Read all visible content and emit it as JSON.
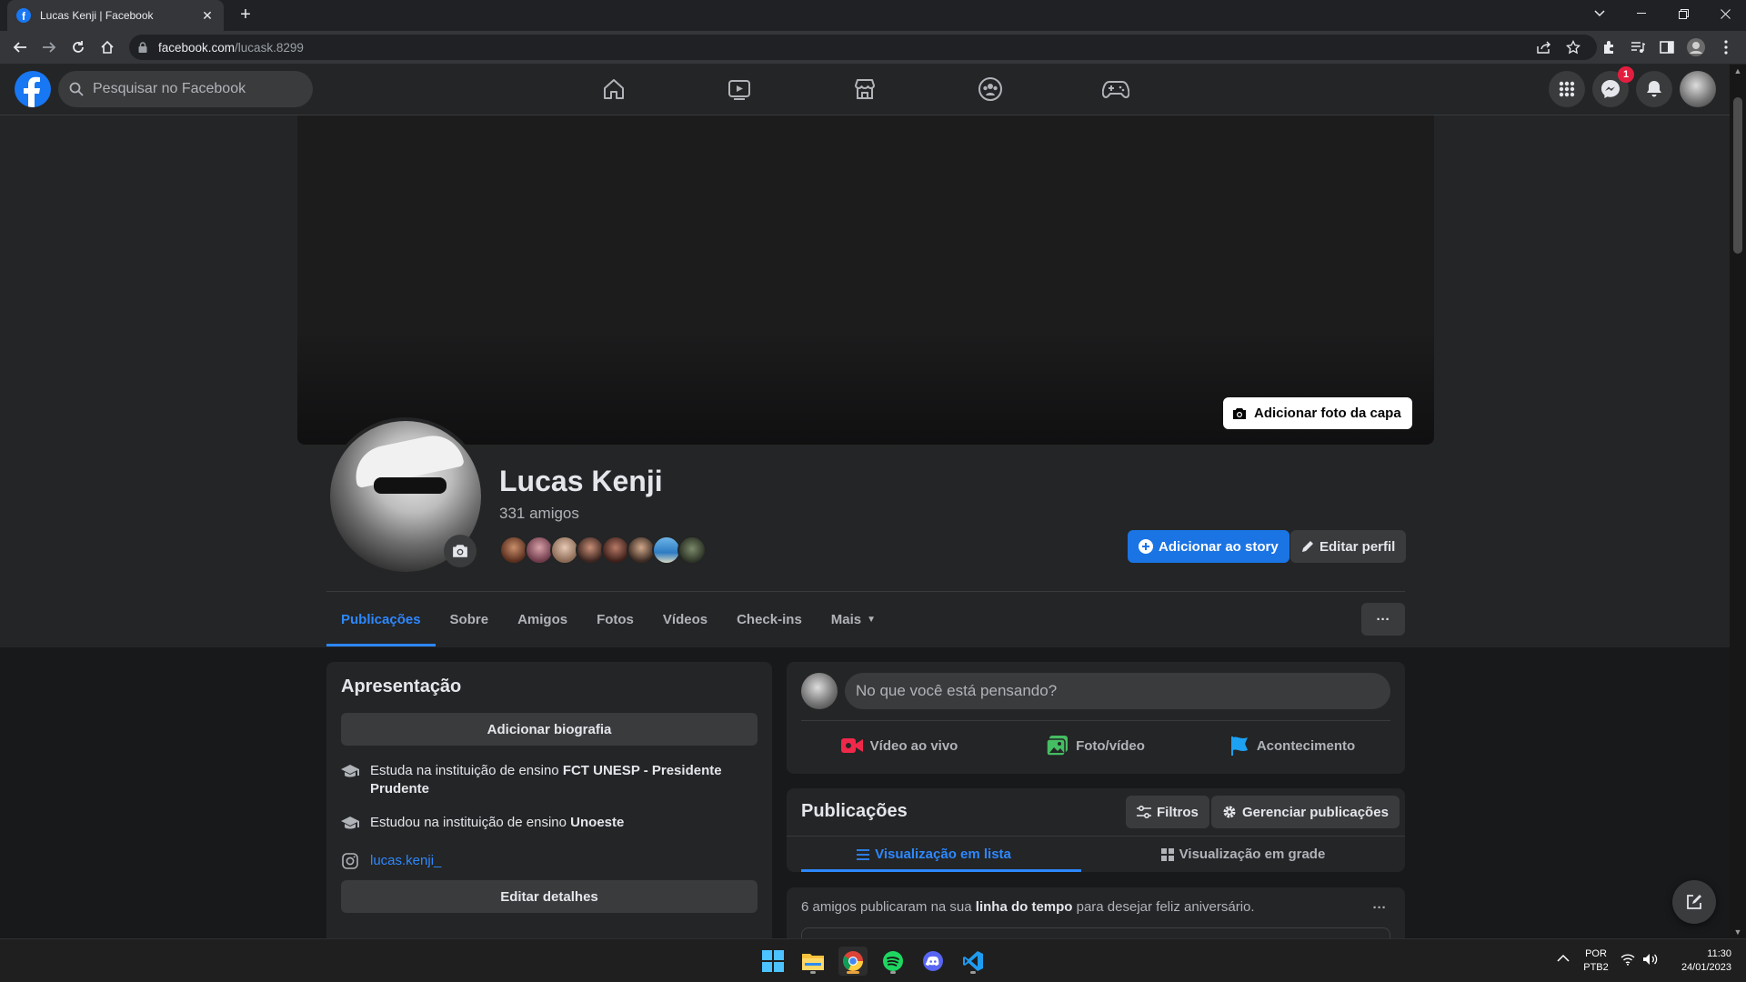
{
  "browser": {
    "tab_title": "Lucas Kenji | Facebook",
    "tab_close": "✕",
    "new_tab": "+",
    "url_host": "facebook.com",
    "url_path": "/lucask.8299"
  },
  "header": {
    "search_placeholder": "Pesquisar no Facebook",
    "nav_icons": [
      "home-icon",
      "watch-icon",
      "marketplace-icon",
      "groups-icon",
      "gaming-icon"
    ],
    "messenger_badge": "1"
  },
  "profile": {
    "add_cover_label": "Adicionar foto da capa",
    "name": "Lucas Kenji",
    "friends_count": "331 amigos",
    "add_story_label": "Adicionar ao story",
    "edit_profile_label": "Editar perfil",
    "tabs": [
      {
        "label": "Publicações"
      },
      {
        "label": "Sobre"
      },
      {
        "label": "Amigos"
      },
      {
        "label": "Fotos"
      },
      {
        "label": "Vídeos"
      },
      {
        "label": "Check-ins"
      },
      {
        "label": "Mais"
      }
    ],
    "tab_more": "···"
  },
  "intro": {
    "title": "Apresentação",
    "add_bio_label": "Adicionar biografia",
    "study_current_prefix": "Estuda na instituição de ensino ",
    "study_current_school": "FCT UNESP - Presidente Prudente",
    "study_past_prefix": "Estudou na instituição de ensino ",
    "study_past_school": "Unoeste",
    "instagram": "lucas.kenji_",
    "edit_details_label": "Editar detalhes"
  },
  "composer": {
    "placeholder": "No que você está pensando?",
    "live_label": "Vídeo ao vivo",
    "photo_label": "Foto/vídeo",
    "event_label": "Acontecimento"
  },
  "posts": {
    "title": "Publicações",
    "filters_label": "Filtros",
    "manage_label": "Gerenciar publicações",
    "list_view_label": "Visualização em lista",
    "grid_view_label": "Visualização em grade",
    "birthday_prefix": "6 amigos publicaram na sua ",
    "birthday_bold": "linha do tempo",
    "birthday_suffix": " para desejar feliz aniversário.",
    "more": "···"
  },
  "taskbar": {
    "lang_line1": "POR",
    "lang_line2": "PTB2",
    "time": "11:30",
    "date": "24/01/2023"
  },
  "colors": {
    "accent": "#2d88ff",
    "fb_blue": "#1877f2",
    "badge_red": "#e41e3f",
    "background": "#18191a",
    "card": "#242526"
  }
}
